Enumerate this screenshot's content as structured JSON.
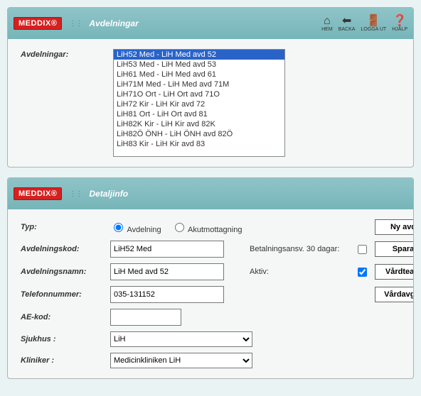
{
  "logo_text": "MEDDIX®",
  "panels": {
    "avdelningar": {
      "title": "Avdelningar",
      "list_label": "Avdelningar:",
      "items": [
        "LiH52 Med - LiH Med avd 52",
        "LiH53 Med - LiH Med avd 53",
        "LiH61 Med - LiH Med avd 61",
        "LiH71M Med - LiH Med avd 71M",
        "LiH71O Ort - LiH Ort avd 71O",
        "LiH72 Kir - LiH Kir avd 72",
        "LiH81 Ort - LiH Ort avd 81",
        "LiH82K Kir - LiH Kir avd 82K",
        "LiH82Ö ÖNH - LiH ÖNH avd 82Ö",
        "LiH83 Kir - LiH Kir avd 83"
      ],
      "selected_index": 0
    },
    "detaljinfo": {
      "title": "Detaljinfo",
      "labels": {
        "typ": "Typ:",
        "avdelningskod": "Avdelningskod:",
        "avdelningsnamn": "Avdelningsnamn:",
        "telefonnummer": "Telefonnummer:",
        "ae_kod": "AE-kod:",
        "sjukhus": "Sjukhus :",
        "kliniker": "Kliniker :",
        "betalningsansv": "Betalningsansv. 30 dagar:",
        "aktiv": "Aktiv:"
      },
      "radio": {
        "avdelning": "Avdelning",
        "akut": "Akutmottagning"
      },
      "values": {
        "avdelningskod": "LiH52 Med",
        "avdelningsnamn": "LiH Med avd 52",
        "telefonnummer": "035-131152",
        "ae_kod": "",
        "sjukhus": "LiH",
        "kliniker": "Medicinkliniken LiH",
        "betalningsansv_checked": false,
        "aktiv_checked": true
      },
      "buttons": {
        "ny_avd": "Ny avd",
        "spara": "Spara",
        "vardteam": "Vårdteam",
        "vardavgift": "Vårdavgift"
      }
    }
  },
  "toolbar": {
    "hem": "HEM",
    "backa": "BACKA",
    "logga_ut": "LOGGA UT",
    "hjalp": "HJÄLP"
  }
}
